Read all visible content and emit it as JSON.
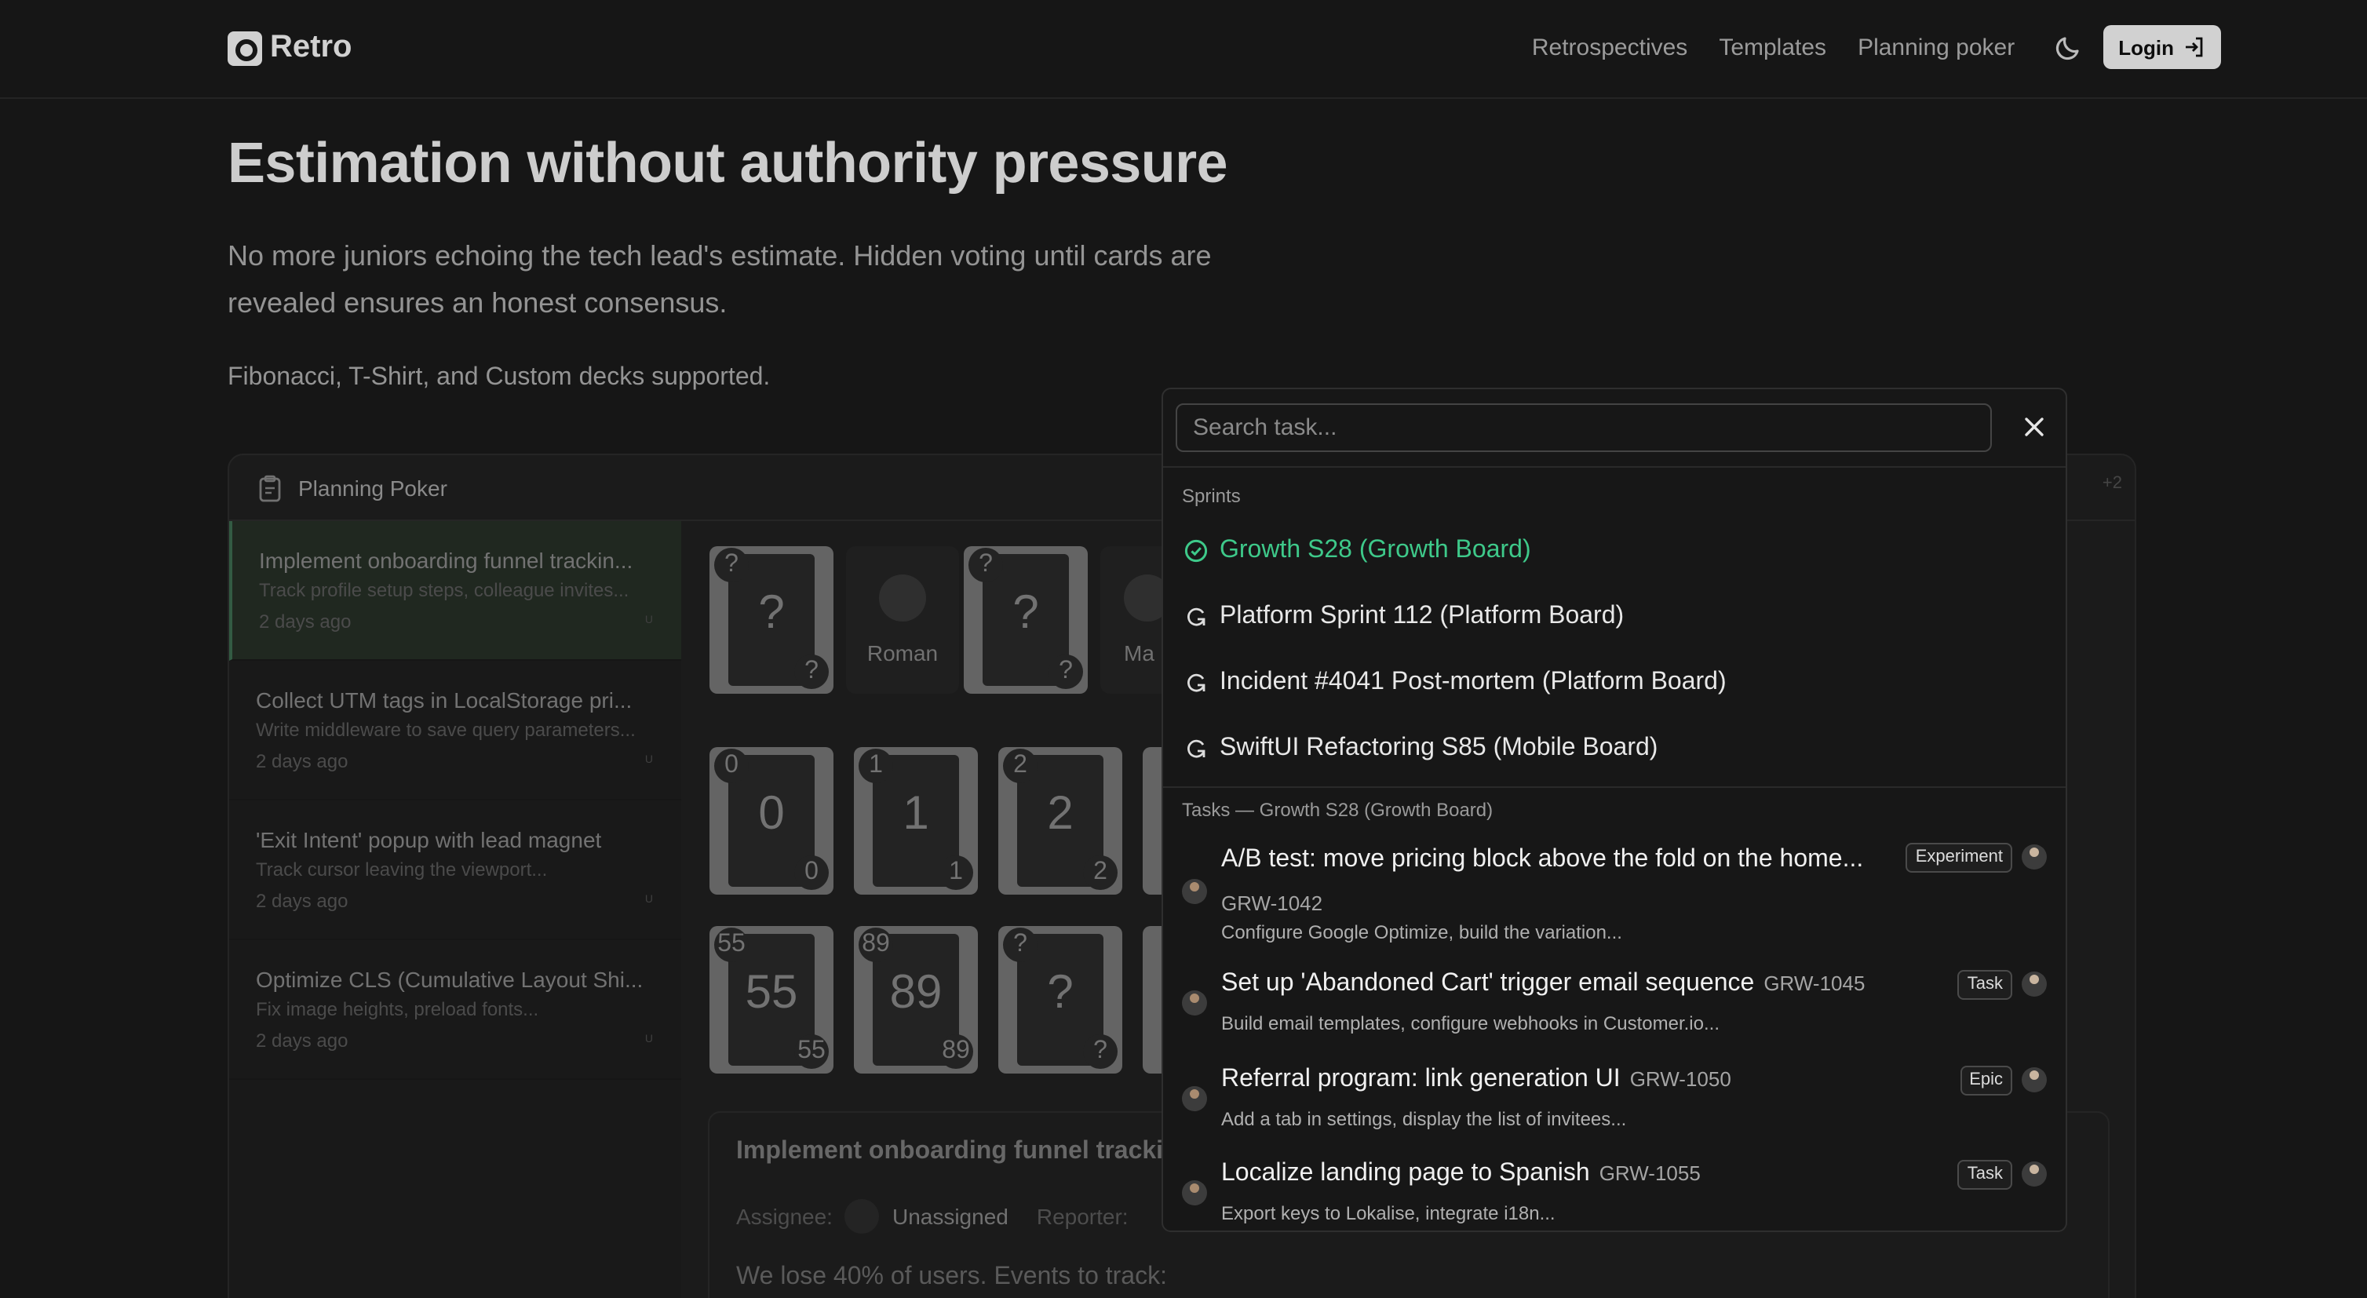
{
  "header": {
    "brand": "Retro",
    "nav": [
      "Retrospectives",
      "Templates",
      "Planning poker"
    ],
    "login_label": "Login"
  },
  "hero": {
    "title": "Estimation without authority pressure",
    "description": "No more juniors echoing the tech lead's estimate. Hidden voting until cards are revealed ensures an honest consensus.",
    "decks": "Fibonacci, T-Shirt, and Custom decks supported."
  },
  "panel": {
    "title": "Planning Poker",
    "more": "+2",
    "tasks": [
      {
        "title": "Implement onboarding funnel trackin...",
        "desc": "Track profile setup steps, colleague invites...",
        "time": "2 days ago",
        "badge": "U"
      },
      {
        "title": "Collect UTM tags in LocalStorage pri...",
        "desc": "Write middleware to save query parameters...",
        "time": "2 days ago",
        "badge": "U"
      },
      {
        "title": "'Exit Intent' popup with lead magnet",
        "desc": "Track cursor leaving the viewport...",
        "time": "2 days ago",
        "badge": "U"
      },
      {
        "title": "Optimize CLS (Cumulative Layout Shi...",
        "desc": "Fix image heights, preload fonts...",
        "time": "2 days ago",
        "badge": "U"
      }
    ],
    "players": {
      "p1": "Roman",
      "p2": "Ma"
    },
    "hidden_card": "?",
    "deck": [
      "0",
      "1",
      "2",
      "55",
      "89",
      "?"
    ],
    "detail": {
      "title": "Implement onboarding funnel trackin",
      "assignee_label": "Assignee:",
      "assignee": "Unassigned",
      "reporter_label": "Reporter:",
      "body": "We lose 40% of users. Events to track:"
    }
  },
  "palette": {
    "search_placeholder": "Search task...",
    "sprints_label": "Sprints",
    "sprints": [
      "Growth S28 (Growth Board)",
      "Platform Sprint 112 (Platform Board)",
      "Incident #4041 Post-mortem (Platform Board)",
      "SwiftUI Refactoring S85 (Mobile Board)"
    ],
    "tasks_label": "Tasks — Growth S28 (Growth Board)",
    "tasks": [
      {
        "title": "A/B test: move pricing block above the fold on the home...",
        "code": "GRW-1042",
        "desc": "Configure Google Optimize, build the variation...",
        "type": "Experiment"
      },
      {
        "title": "Set up 'Abandoned Cart' trigger email sequence",
        "code": "GRW-1045",
        "desc": "Build email templates, configure webhooks in Customer.io...",
        "type": "Task"
      },
      {
        "title": "Referral program: link generation UI",
        "code": "GRW-1050",
        "desc": "Add a tab in settings, display the list of invitees...",
        "type": "Epic"
      },
      {
        "title": "Localize landing page to Spanish",
        "code": "GRW-1055",
        "desc": "Export keys to Lokalise, integrate i18n...",
        "type": "Task"
      }
    ]
  },
  "colors": {
    "selected_sprint": "#3ec98a",
    "background": "#1c1c1c"
  }
}
